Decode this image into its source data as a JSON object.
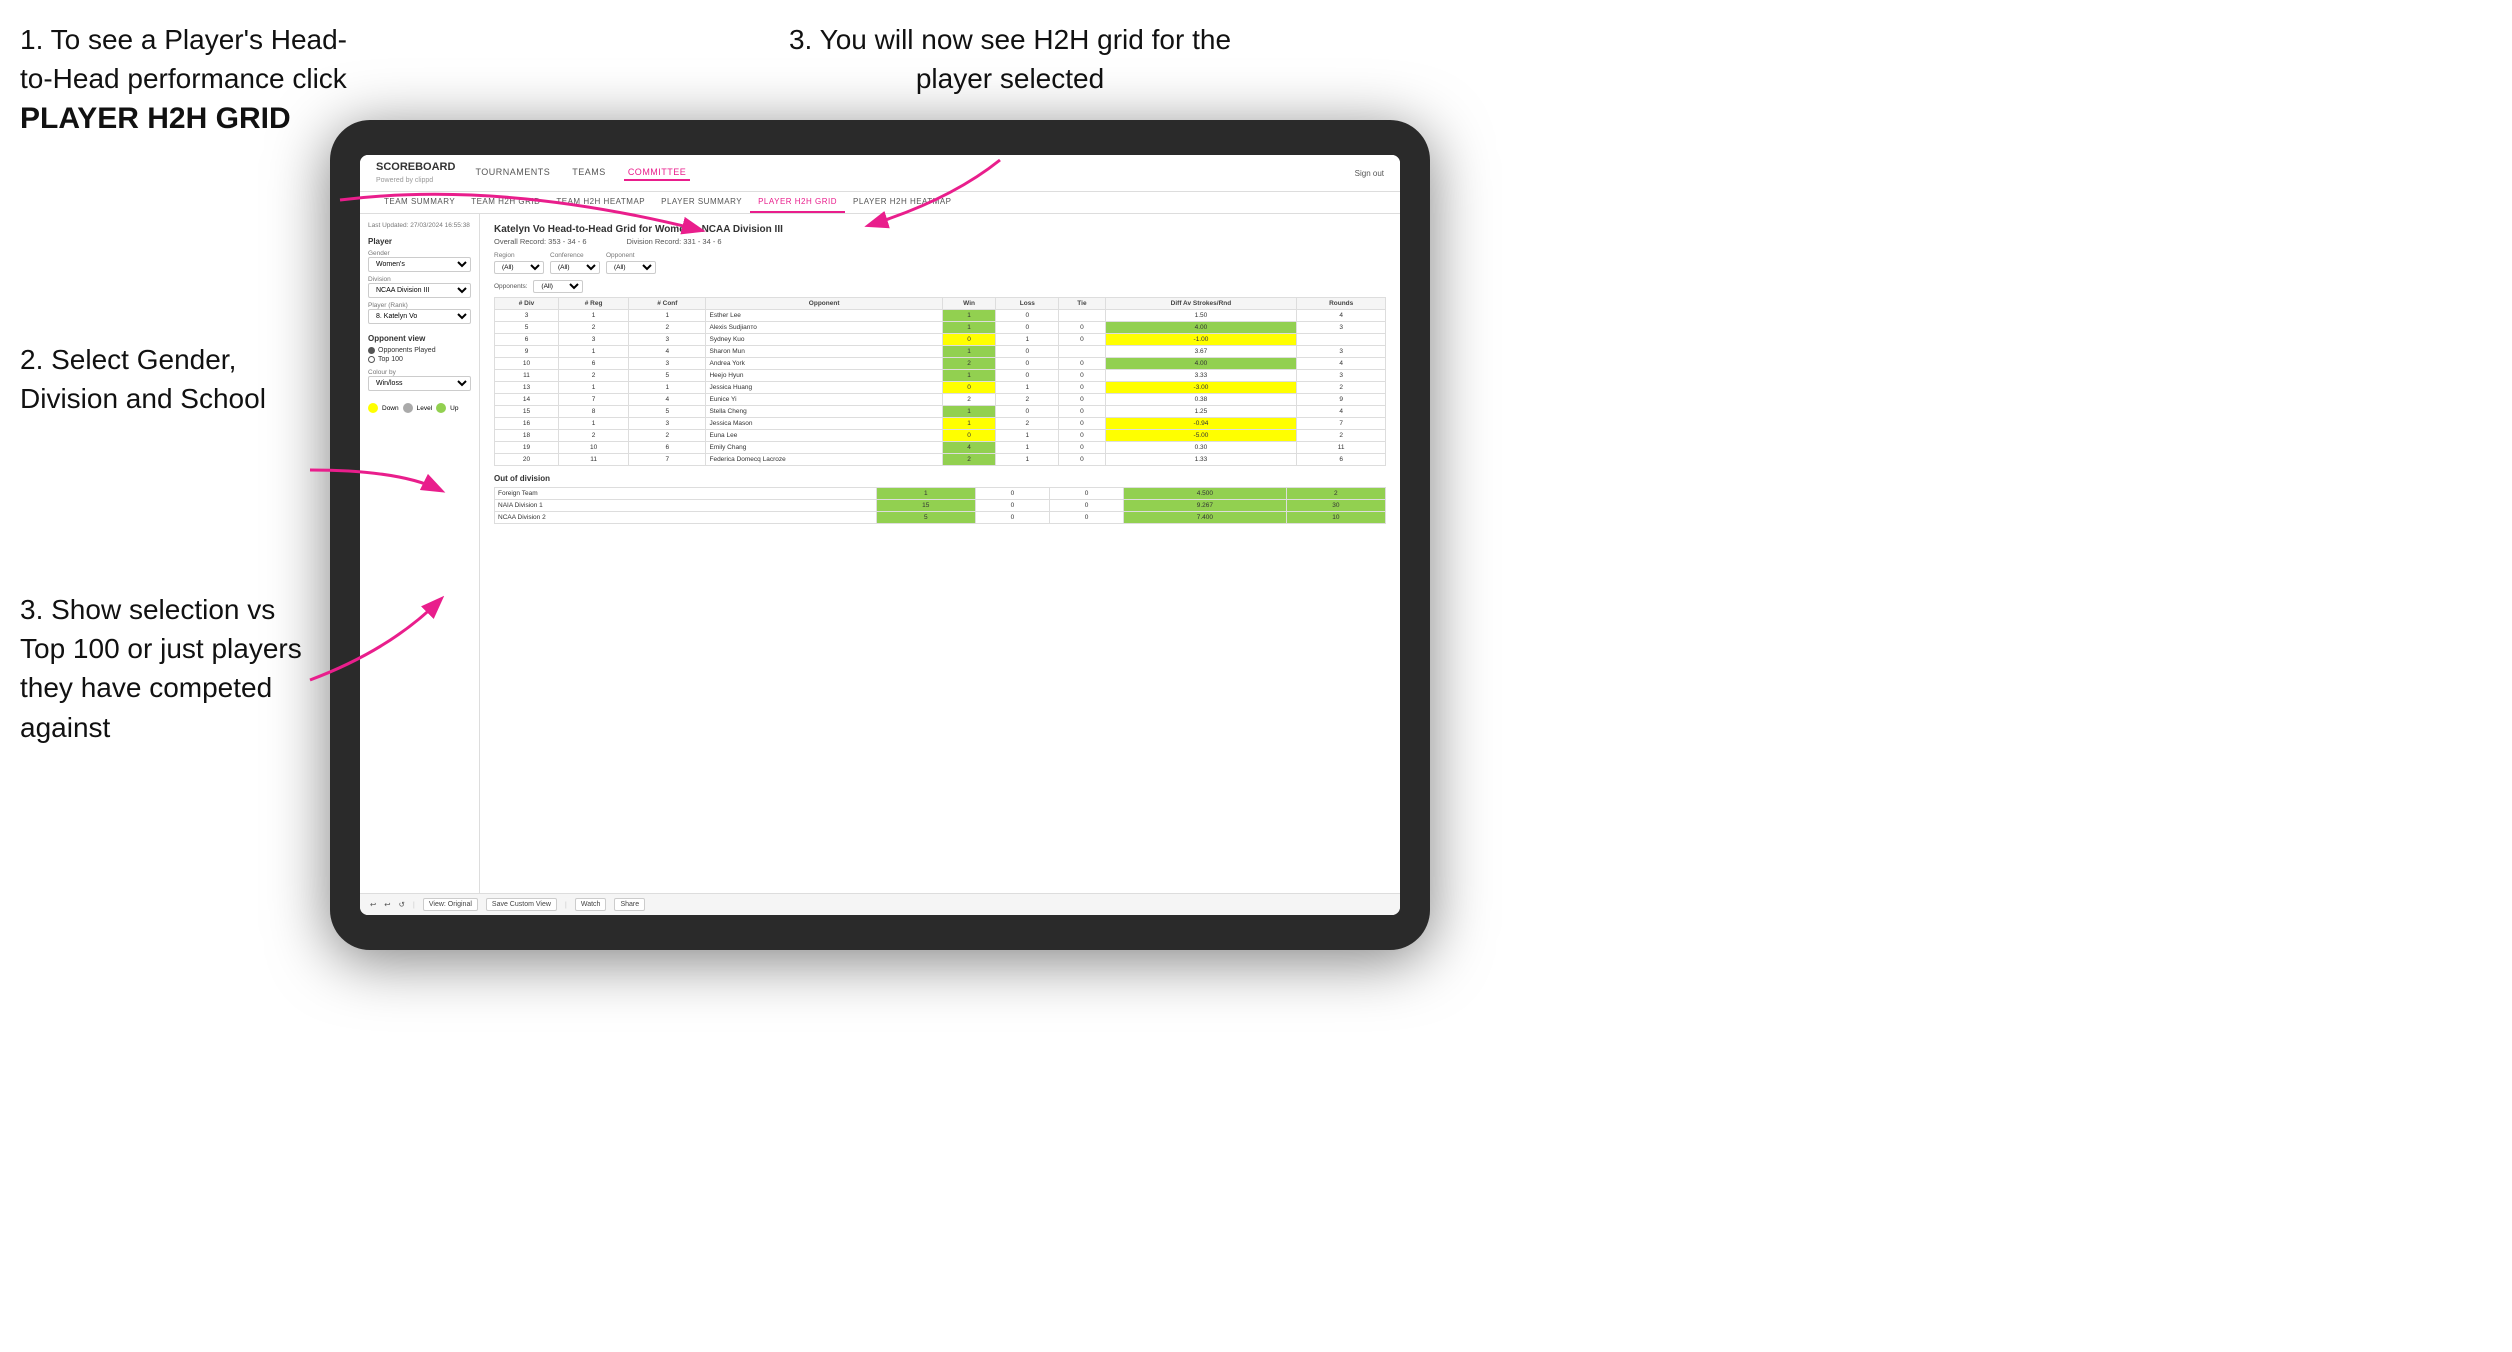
{
  "instructions": {
    "step1_title": "1. To see a Player's Head-to-Head performance click",
    "step1_bold": "PLAYER H2H GRID",
    "step3_title": "3. You will now see H2H grid for the player selected",
    "step2_title": "2. Select Gender, Division and School",
    "step3b_title": "3. Show selection vs Top 100 or just players they have competed against"
  },
  "nav": {
    "logo": "SCOREBOARD",
    "powered": "Powered by clippd",
    "links": [
      "TOURNAMENTS",
      "TEAMS",
      "COMMITTEE"
    ],
    "active_link": "COMMITTEE",
    "sign_out": "Sign out"
  },
  "sub_nav": {
    "links": [
      "TEAM SUMMARY",
      "TEAM H2H GRID",
      "TEAM H2H HEATMAP",
      "PLAYER SUMMARY",
      "PLAYER H2H GRID",
      "PLAYER H2H HEATMAP"
    ],
    "active": "PLAYER H2H GRID"
  },
  "left_panel": {
    "timestamp": "Last Updated: 27/03/2024 16:55:38",
    "player_section": "Player",
    "gender_label": "Gender",
    "gender_value": "Women's",
    "division_label": "Division",
    "division_value": "NCAA Division III",
    "player_rank_label": "Player (Rank)",
    "player_rank_value": "8. Katelyn Vo",
    "opponent_view_label": "Opponent view",
    "opponent_options": [
      "Opponents Played",
      "Top 100"
    ],
    "opponent_selected": "Opponents Played",
    "colour_by_label": "Colour by",
    "colour_by_value": "Win/loss",
    "legend": {
      "down_label": "Down",
      "level_label": "Level",
      "up_label": "Up"
    }
  },
  "main": {
    "title": "Katelyn Vo Head-to-Head Grid for Women's NCAA Division III",
    "overall_record": "Overall Record: 353 - 34 - 6",
    "division_record": "Division Record: 331 - 34 - 6",
    "filters": {
      "region_label": "Region",
      "conference_label": "Conference",
      "opponent_label": "Opponent",
      "opponents_label": "Opponents:",
      "region_value": "(All)",
      "conference_value": "(All)",
      "opponent_value": "(All)"
    },
    "table_headers": [
      "# Div",
      "# Reg",
      "# Conf",
      "Opponent",
      "Win",
      "Loss",
      "Tie",
      "Diff Av Strokes/Rnd",
      "Rounds"
    ],
    "rows": [
      {
        "div": "3",
        "reg": "1",
        "conf": "1",
        "opponent": "Esther Lee",
        "win": "1",
        "loss": "0",
        "tie": "",
        "diff": "1.50",
        "rounds": "4",
        "win_color": "green",
        "diff_color": ""
      },
      {
        "div": "5",
        "reg": "2",
        "conf": "2",
        "opponent": "Alexis Sudjianто",
        "win": "1",
        "loss": "0",
        "tie": "0",
        "diff": "4.00",
        "rounds": "3",
        "win_color": "green",
        "diff_color": "green"
      },
      {
        "div": "6",
        "reg": "3",
        "conf": "3",
        "opponent": "Sydney Kuo",
        "win": "0",
        "loss": "1",
        "tie": "0",
        "diff": "-1.00",
        "rounds": "",
        "win_color": "yellow",
        "diff_color": "yellow"
      },
      {
        "div": "9",
        "reg": "1",
        "conf": "4",
        "opponent": "Sharon Mun",
        "win": "1",
        "loss": "0",
        "tie": "",
        "diff": "3.67",
        "rounds": "3",
        "win_color": "green",
        "diff_color": ""
      },
      {
        "div": "10",
        "reg": "6",
        "conf": "3",
        "opponent": "Andrea York",
        "win": "2",
        "loss": "0",
        "tie": "0",
        "diff": "4.00",
        "rounds": "4",
        "win_color": "green",
        "diff_color": "green"
      },
      {
        "div": "11",
        "reg": "2",
        "conf": "5",
        "opponent": "Heejo Hyun",
        "win": "1",
        "loss": "0",
        "tie": "0",
        "diff": "3.33",
        "rounds": "3",
        "win_color": "green",
        "diff_color": ""
      },
      {
        "div": "13",
        "reg": "1",
        "conf": "1",
        "opponent": "Jessica Huang",
        "win": "0",
        "loss": "1",
        "tie": "0",
        "diff": "-3.00",
        "rounds": "2",
        "win_color": "yellow",
        "diff_color": "yellow"
      },
      {
        "div": "14",
        "reg": "7",
        "conf": "4",
        "opponent": "Eunice Yi",
        "win": "2",
        "loss": "2",
        "tie": "0",
        "diff": "0.38",
        "rounds": "9",
        "win_color": "",
        "diff_color": ""
      },
      {
        "div": "15",
        "reg": "8",
        "conf": "5",
        "opponent": "Stella Cheng",
        "win": "1",
        "loss": "0",
        "tie": "0",
        "diff": "1.25",
        "rounds": "4",
        "win_color": "green",
        "diff_color": ""
      },
      {
        "div": "16",
        "reg": "1",
        "conf": "3",
        "opponent": "Jessica Mason",
        "win": "1",
        "loss": "2",
        "tie": "0",
        "diff": "-0.94",
        "rounds": "7",
        "win_color": "yellow",
        "diff_color": "yellow"
      },
      {
        "div": "18",
        "reg": "2",
        "conf": "2",
        "opponent": "Euna Lee",
        "win": "0",
        "loss": "1",
        "tie": "0",
        "diff": "-5.00",
        "rounds": "2",
        "win_color": "yellow",
        "diff_color": "yellow"
      },
      {
        "div": "19",
        "reg": "10",
        "conf": "6",
        "opponent": "Emily Chang",
        "win": "4",
        "loss": "1",
        "tie": "0",
        "diff": "0.30",
        "rounds": "11",
        "win_color": "green",
        "diff_color": ""
      },
      {
        "div": "20",
        "reg": "11",
        "conf": "7",
        "opponent": "Federica Domecq Lacroze",
        "win": "2",
        "loss": "1",
        "tie": "0",
        "diff": "1.33",
        "rounds": "6",
        "win_color": "green",
        "diff_color": ""
      }
    ],
    "out_of_division_label": "Out of division",
    "out_of_division_rows": [
      {
        "team": "Foreign Team",
        "win": "1",
        "loss": "0",
        "tie": "0",
        "diff": "4.500",
        "rounds": "2"
      },
      {
        "team": "NAIA Division 1",
        "win": "15",
        "loss": "0",
        "tie": "0",
        "diff": "9.267",
        "rounds": "30"
      },
      {
        "team": "NCAA Division 2",
        "win": "5",
        "loss": "0",
        "tie": "0",
        "diff": "7.400",
        "rounds": "10"
      }
    ]
  },
  "toolbar": {
    "view_original": "View: Original",
    "save_custom": "Save Custom View",
    "watch": "Watch",
    "share": "Share"
  }
}
